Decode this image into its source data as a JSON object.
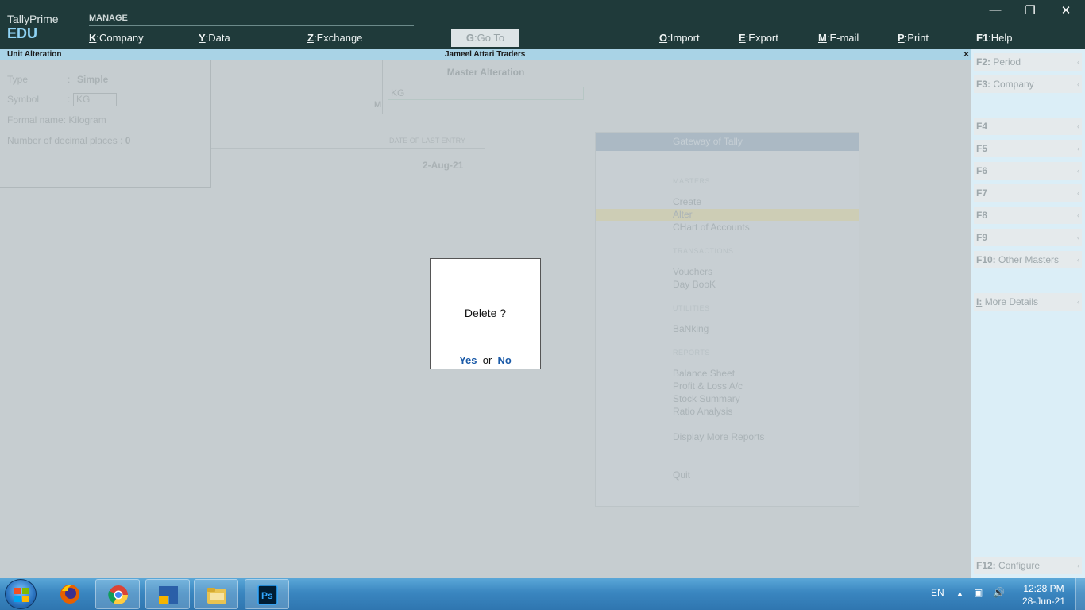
{
  "app": {
    "name": "TallyPrime",
    "edition": "EDU",
    "section_label": "MANAGE"
  },
  "menu": [
    {
      "key": "K",
      "label": "Company"
    },
    {
      "key": "Y",
      "label": "Data"
    },
    {
      "key": "Z",
      "label": "Exchange"
    },
    {
      "key": "G",
      "label": "Go To"
    },
    {
      "key": "O",
      "label": "Import"
    },
    {
      "key": "E",
      "label": "Export"
    },
    {
      "key": "M",
      "label": "E-mail"
    },
    {
      "key": "P",
      "label": "Print"
    },
    {
      "key": "F1",
      "label": "Help"
    }
  ],
  "titlebar": {
    "screen": "Unit Alteration",
    "company": "Jameel Attari Traders",
    "close": "×"
  },
  "unit": {
    "type_label": "Type",
    "type_value": "Simple",
    "symbol_label": "Symbol",
    "symbol_value": "KG",
    "formal_label": "Formal name:",
    "formal_value": "Kilogram",
    "decimals_label": "Number of decimal places",
    "decimals_value": "0",
    "sep": ":"
  },
  "master_alteration": {
    "title": "Master Alteration",
    "value": "KG",
    "side_label": "M"
  },
  "list": {
    "header": "DATE OF LAST ENTRY",
    "date": "2-Aug-21"
  },
  "gateway": {
    "title": "Gateway of Tally",
    "sections": [
      {
        "name": "MASTERS",
        "items": [
          "Create",
          "Alter",
          "CHart of Accounts"
        ]
      },
      {
        "name": "TRANSACTIONS",
        "items": [
          "Vouchers",
          "Day BooK"
        ]
      },
      {
        "name": "UTILITIES",
        "items": [
          "BaNking"
        ]
      },
      {
        "name": "REPORTS",
        "items": [
          "Balance Sheet",
          "Profit & Loss A/c",
          "Stock Summary",
          "Ratio Analysis"
        ]
      }
    ],
    "more": "Display More Reports",
    "quit": "Quit"
  },
  "fkeys": [
    {
      "key": "F2:",
      "label": "Period"
    },
    {
      "key": "F3:",
      "label": "Company"
    },
    {
      "key": "F4",
      "label": ""
    },
    {
      "key": "F5",
      "label": ""
    },
    {
      "key": "F6",
      "label": ""
    },
    {
      "key": "F7",
      "label": ""
    },
    {
      "key": "F8",
      "label": ""
    },
    {
      "key": "F9",
      "label": ""
    },
    {
      "key": "F10:",
      "label": "Other Masters"
    },
    {
      "key": "I:",
      "label": "More Details"
    },
    {
      "key": "F12:",
      "label": "Configure"
    }
  ],
  "dialog": {
    "question": "Delete ?",
    "yes": "Yes",
    "or": "or",
    "no": "No"
  },
  "taskbar": {
    "lang": "EN",
    "time": "12:28 PM",
    "date": "28-Jun-21"
  },
  "colors": {
    "header_bg": "#1f3a3a",
    "title_bg": "#a9d3e6",
    "fbar_bg": "#dbeef7",
    "accent_link": "#1a5aa8"
  }
}
